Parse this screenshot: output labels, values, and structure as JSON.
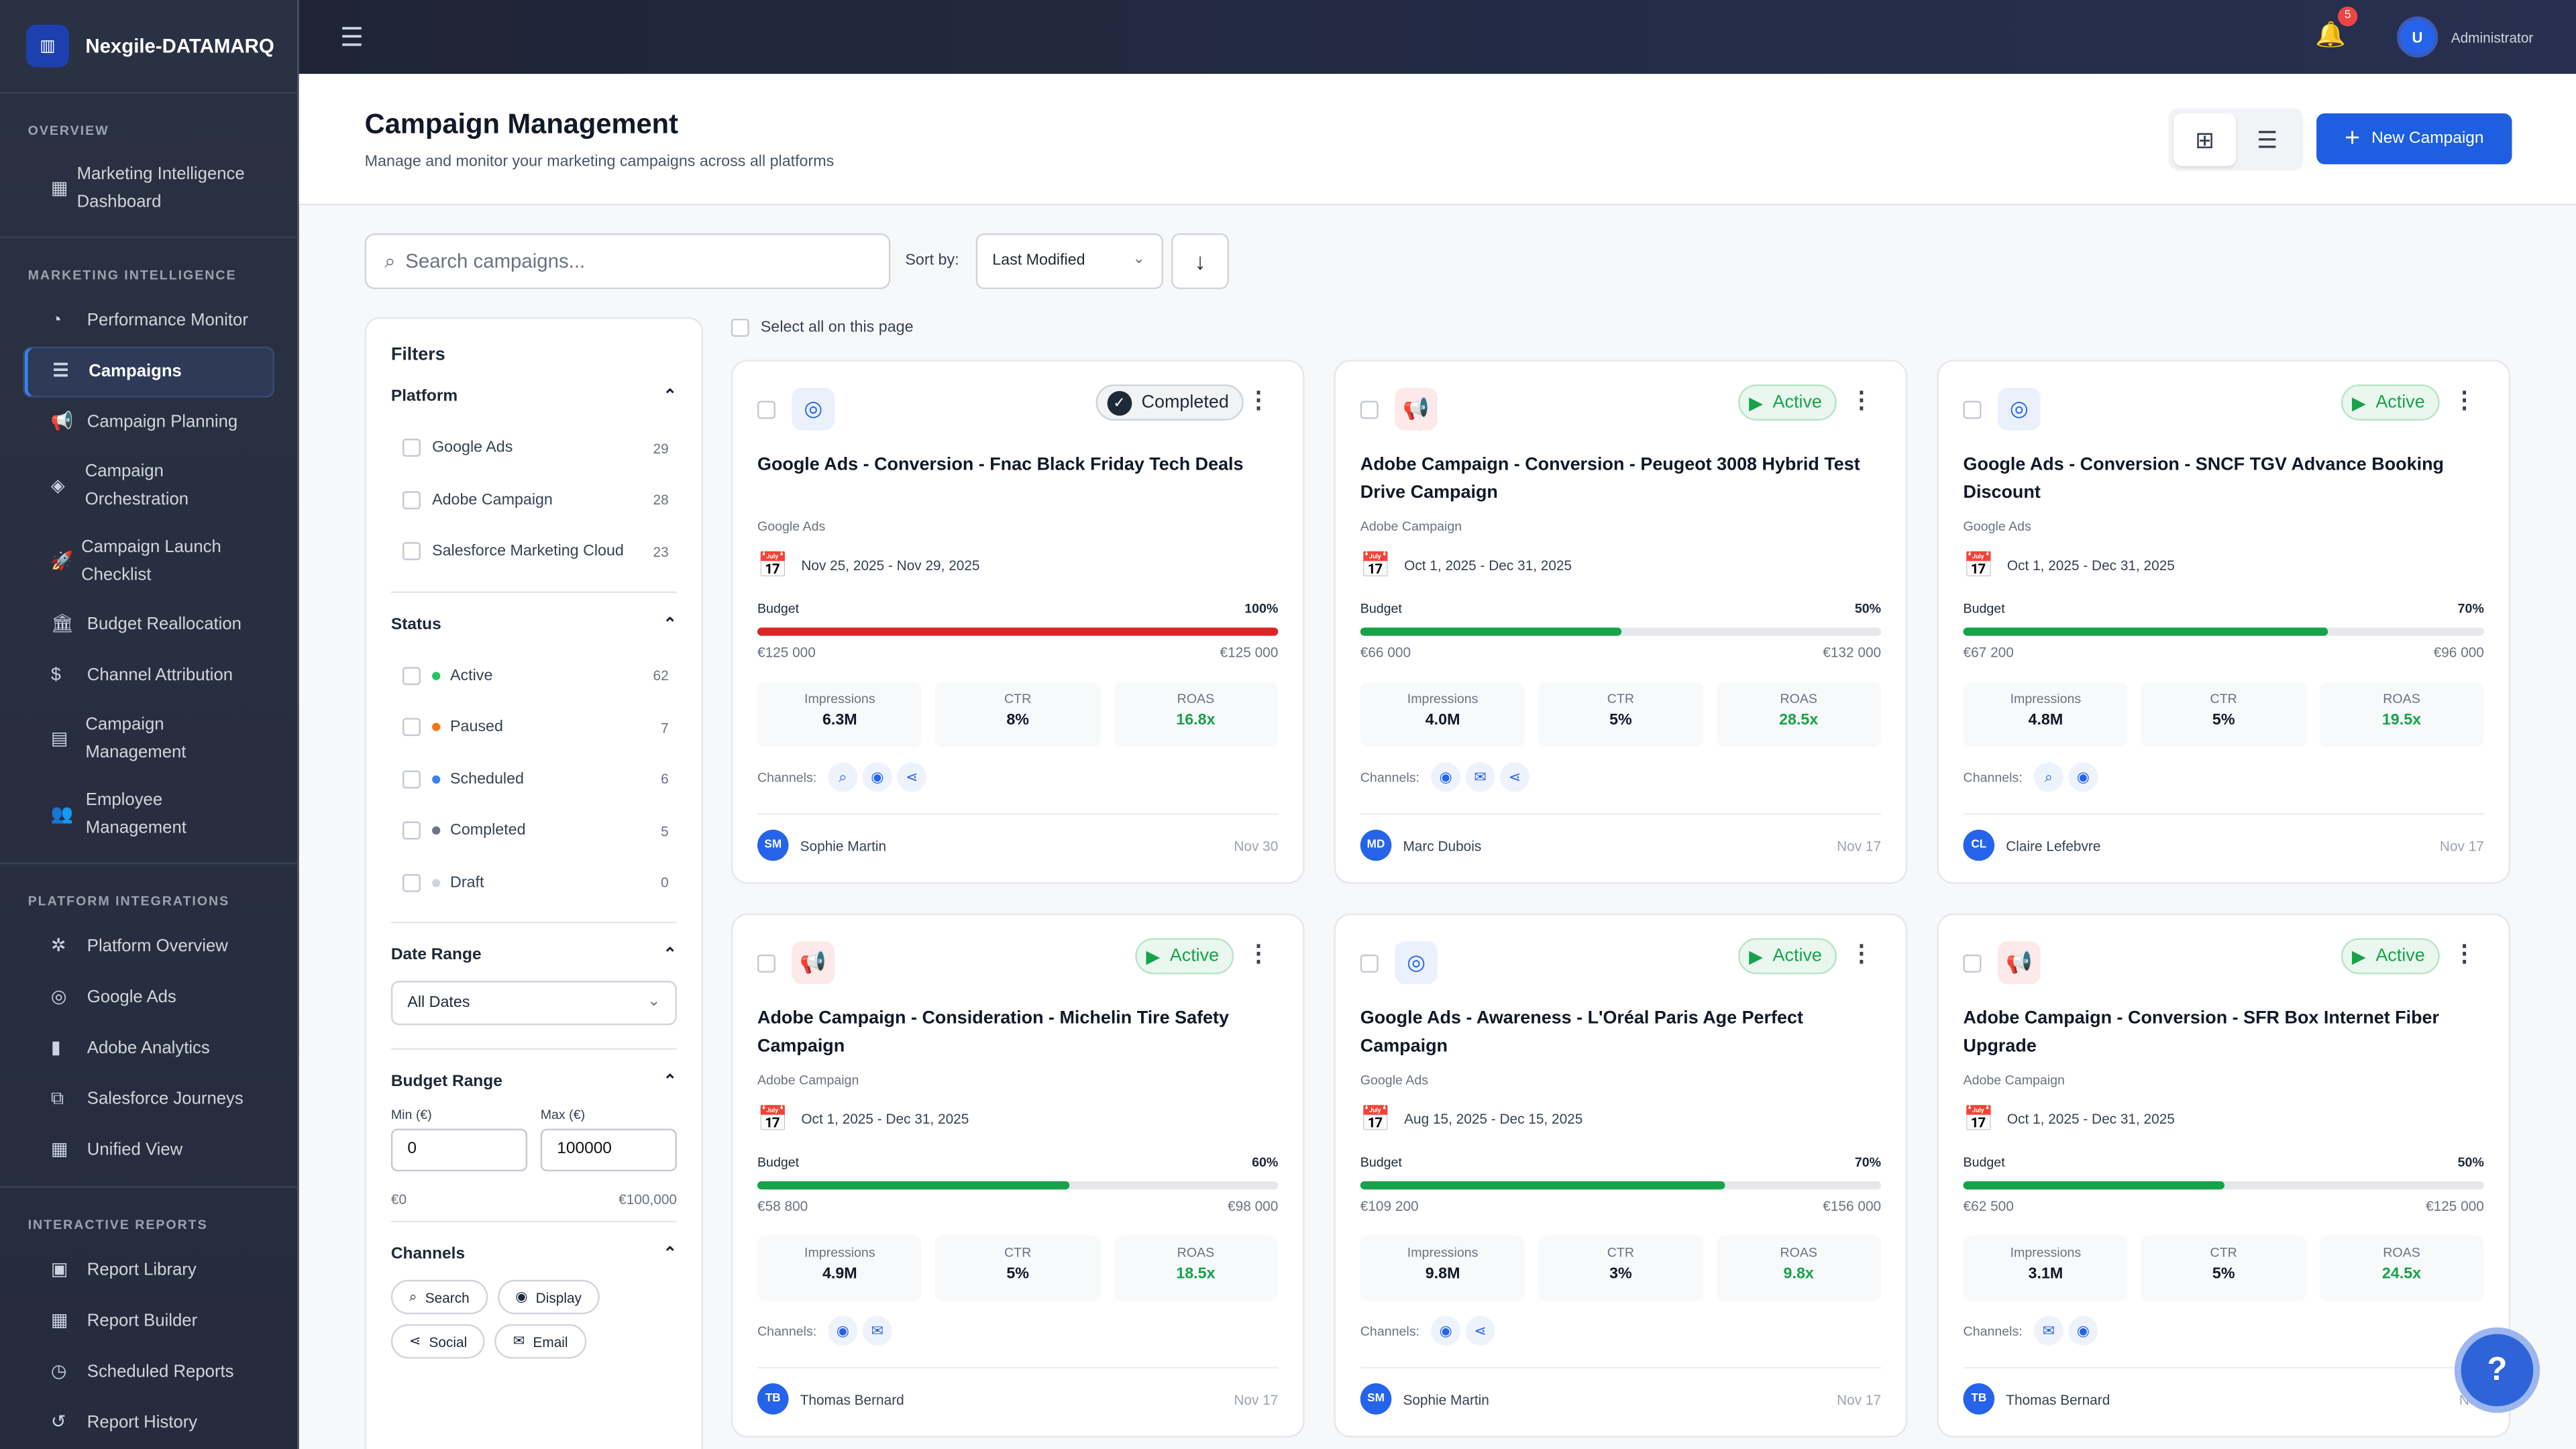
{
  "app": {
    "name": "Nexgile-DATAMARQ"
  },
  "sidebar": {
    "sections": [
      {
        "title": "OVERVIEW",
        "items": [
          {
            "label": "Marketing Intelligence Dashboard",
            "icon": "dashboard-icon",
            "glyph": "▦"
          }
        ]
      },
      {
        "title": "MARKETING INTELLIGENCE",
        "items": [
          {
            "label": "Performance Monitor",
            "icon": "speedometer-icon",
            "glyph": "◔"
          },
          {
            "label": "Campaigns",
            "icon": "checklist-icon",
            "glyph": "☰",
            "active": true
          },
          {
            "label": "Campaign Planning",
            "icon": "megaphone-icon",
            "glyph": "📢"
          },
          {
            "label": "Campaign Orchestration",
            "icon": "layers-icon",
            "glyph": "◈"
          },
          {
            "label": "Campaign Launch Checklist",
            "icon": "rocket-icon",
            "glyph": "🚀"
          },
          {
            "label": "Budget Reallocation",
            "icon": "bank-icon",
            "glyph": "🏛"
          },
          {
            "label": "Channel Attribution",
            "icon": "dollar-icon",
            "glyph": "$"
          },
          {
            "label": "Campaign Management",
            "icon": "building-icon",
            "glyph": "▤"
          },
          {
            "label": "Employee Management",
            "icon": "people-icon",
            "glyph": "👥"
          }
        ]
      },
      {
        "title": "PLATFORM INTEGRATIONS",
        "items": [
          {
            "label": "Platform Overview",
            "icon": "hub-icon",
            "glyph": "✲"
          },
          {
            "label": "Google Ads",
            "icon": "ads-click-icon",
            "glyph": "◎"
          },
          {
            "label": "Adobe Analytics",
            "icon": "bar-chart-icon",
            "glyph": "▮"
          },
          {
            "label": "Salesforce Journeys",
            "icon": "flow-icon",
            "glyph": "⧉"
          },
          {
            "label": "Unified View",
            "icon": "grid-icon",
            "glyph": "▦"
          }
        ]
      },
      {
        "title": "INTERACTIVE REPORTS",
        "items": [
          {
            "label": "Report Library",
            "icon": "library-icon",
            "glyph": "▣"
          },
          {
            "label": "Report Builder",
            "icon": "builder-icon",
            "glyph": "▦"
          },
          {
            "label": "Scheduled Reports",
            "icon": "clock-icon",
            "glyph": "◷"
          },
          {
            "label": "Report History",
            "icon": "history-icon",
            "glyph": "↺"
          }
        ]
      }
    ]
  },
  "topbar": {
    "notifications": "5",
    "user_initial": "U",
    "user_name": "Administrator"
  },
  "header": {
    "title": "Campaign Management",
    "subtitle": "Manage and monitor your marketing campaigns across all platforms",
    "new_campaign": "New Campaign"
  },
  "toolbar": {
    "search_placeholder": "Search campaigns...",
    "sort_label": "Sort by:",
    "sort_value": "Last Modified",
    "select_all": "Select all on this page"
  },
  "filters": {
    "title": "Filters",
    "platform": {
      "title": "Platform",
      "options": [
        {
          "label": "Google Ads",
          "count": "29"
        },
        {
          "label": "Adobe Campaign",
          "count": "28"
        },
        {
          "label": "Salesforce Marketing Cloud",
          "count": "23"
        }
      ]
    },
    "status": {
      "title": "Status",
      "options": [
        {
          "label": "Active",
          "count": "62",
          "color": "#22c55e"
        },
        {
          "label": "Paused",
          "count": "7",
          "color": "#f97316"
        },
        {
          "label": "Scheduled",
          "count": "6",
          "color": "#3b82f6"
        },
        {
          "label": "Completed",
          "count": "5",
          "color": "#6b7280"
        },
        {
          "label": "Draft",
          "count": "0",
          "color": "#d1d5db"
        }
      ]
    },
    "date_range": {
      "title": "Date Range",
      "value": "All Dates"
    },
    "budget_range": {
      "title": "Budget Range",
      "min_label": "Min (€)",
      "max_label": "Max (€)",
      "min": "0",
      "max": "100000",
      "low": "€0",
      "high": "€100,000"
    },
    "channels": {
      "title": "Channels",
      "options": [
        {
          "label": "Search",
          "glyph": "⌕",
          "icon": "search-icon"
        },
        {
          "label": "Display",
          "glyph": "◉",
          "icon": "eye-icon"
        },
        {
          "label": "Social",
          "glyph": "⋖",
          "icon": "share-icon"
        },
        {
          "label": "Email",
          "glyph": "✉",
          "icon": "email-icon"
        }
      ]
    }
  },
  "colors": {
    "google": "#2563eb",
    "adobe": "#dc2626",
    "bar_full": "#dc2626",
    "bar": "#16a34a",
    "accent": "#1d5fe0"
  },
  "campaigns": [
    {
      "title": "Google Ads - Conversion - Fnac Black Friday Tech Deals",
      "platform": "Google Ads",
      "status": "Completed",
      "dates": "Nov 25, 2025 - Nov 29, 2025",
      "budget_label": "Budget",
      "pct": "100%",
      "progress": 100,
      "spent": "€125 000",
      "total": "€125 000",
      "impressions": "6.3M",
      "ctr": "8%",
      "roas": "16.8x",
      "channels": [
        "search",
        "display",
        "social"
      ],
      "owner": "Sophie Martin",
      "initials": "SM",
      "date": "Nov 30"
    },
    {
      "title": "Adobe Campaign - Conversion - Peugeot 3008 Hybrid Test Drive Campaign",
      "platform": "Adobe Campaign",
      "status": "Active",
      "dates": "Oct 1, 2025 - Dec 31, 2025",
      "budget_label": "Budget",
      "pct": "50%",
      "progress": 50,
      "spent": "€66 000",
      "total": "€132 000",
      "impressions": "4.0M",
      "ctr": "5%",
      "roas": "28.5x",
      "channels": [
        "display",
        "email",
        "social"
      ],
      "owner": "Marc Dubois",
      "initials": "MD",
      "date": "Nov 17"
    },
    {
      "title": "Google Ads - Conversion - SNCF TGV Advance Booking Discount",
      "platform": "Google Ads",
      "status": "Active",
      "dates": "Oct 1, 2025 - Dec 31, 2025",
      "budget_label": "Budget",
      "pct": "70%",
      "progress": 70,
      "spent": "€67 200",
      "total": "€96 000",
      "impressions": "4.8M",
      "ctr": "5%",
      "roas": "19.5x",
      "channels": [
        "search",
        "display"
      ],
      "owner": "Claire Lefebvre",
      "initials": "CL",
      "date": "Nov 17"
    },
    {
      "title": "Adobe Campaign - Consideration - Michelin Tire Safety Campaign",
      "platform": "Adobe Campaign",
      "status": "Active",
      "dates": "Oct 1, 2025 - Dec 31, 2025",
      "budget_label": "Budget",
      "pct": "60%",
      "progress": 60,
      "spent": "€58 800",
      "total": "€98 000",
      "impressions": "4.9M",
      "ctr": "5%",
      "roas": "18.5x",
      "channels": [
        "display",
        "email"
      ],
      "owner": "Thomas Bernard",
      "initials": "TB",
      "date": "Nov 17"
    },
    {
      "title": "Google Ads - Awareness - L'Oréal Paris Age Perfect Campaign",
      "platform": "Google Ads",
      "status": "Active",
      "dates": "Aug 15, 2025 - Dec 15, 2025",
      "budget_label": "Budget",
      "pct": "70%",
      "progress": 70,
      "spent": "€109 200",
      "total": "€156 000",
      "impressions": "9.8M",
      "ctr": "3%",
      "roas": "9.8x",
      "channels": [
        "display",
        "social"
      ],
      "owner": "Sophie Martin",
      "initials": "SM",
      "date": "Nov 17"
    },
    {
      "title": "Adobe Campaign - Conversion - SFR Box Internet Fiber Upgrade",
      "platform": "Adobe Campaign",
      "status": "Active",
      "dates": "Oct 1, 2025 - Dec 31, 2025",
      "budget_label": "Budget",
      "pct": "50%",
      "progress": 50,
      "spent": "€62 500",
      "total": "€125 000",
      "impressions": "3.1M",
      "ctr": "5%",
      "roas": "24.5x",
      "channels": [
        "email",
        "display"
      ],
      "owner": "Thomas Bernard",
      "initials": "TB",
      "date": "Nov"
    }
  ],
  "metric_labels": {
    "impressions": "Impressions",
    "ctr": "CTR",
    "roas": "ROAS",
    "channels": "Channels:"
  }
}
